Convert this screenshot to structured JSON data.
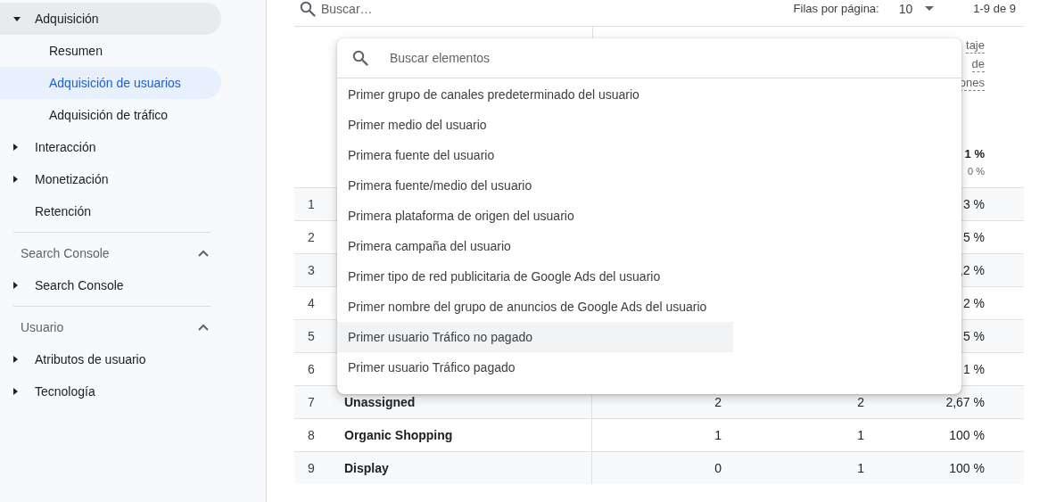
{
  "sidebar": {
    "sections": [
      {
        "items": [
          {
            "label": "Adquisición",
            "kind": "folder",
            "expanded": true,
            "hovered": true,
            "children": [
              {
                "label": "Resumen",
                "selected": false
              },
              {
                "label": "Adquisición de usuarios",
                "selected": true
              },
              {
                "label": "Adquisición de tráfico",
                "selected": false
              }
            ]
          },
          {
            "label": "Interacción",
            "kind": "folder",
            "expanded": false,
            "hovered": false
          },
          {
            "label": "Monetización",
            "kind": "folder",
            "expanded": false,
            "hovered": false
          },
          {
            "label": "Retención",
            "kind": "link",
            "hovered": false
          }
        ]
      },
      {
        "title": "Search Console",
        "expanded": true,
        "items": [
          {
            "label": "Search Console",
            "kind": "folder",
            "expanded": false,
            "hovered": false
          }
        ]
      },
      {
        "title": "Usuario",
        "expanded": true,
        "items": [
          {
            "label": "Atributos de usuario",
            "kind": "folder",
            "expanded": false,
            "hovered": false
          },
          {
            "label": "Tecnología",
            "kind": "folder",
            "expanded": false,
            "hovered": false
          }
        ]
      }
    ]
  },
  "table": {
    "toolbar": {
      "search_placeholder": "Buscar…",
      "rows_per_page_label": "Filas por página:",
      "rows_per_page": "10",
      "range": "1-9 de 9"
    },
    "header": {
      "column_5_lines": [
        "taje",
        "de",
        "ones"
      ],
      "column_5_total": "1 %",
      "column_5_subtotal": "0 %"
    },
    "rows": [
      {
        "number": "1",
        "column_5": "3 %"
      },
      {
        "number": "2",
        "column_5": "5 %"
      },
      {
        "number": "3",
        "column_5": ",2 %"
      },
      {
        "number": "4",
        "column_5": "2 %"
      },
      {
        "number": "5",
        "column_5": "5 %"
      },
      {
        "number": "6",
        "column_5": "1 %"
      },
      {
        "number": "7",
        "dimension": "Unassigned",
        "column_3": "2",
        "column_4": "2",
        "column_5": "2,67 %"
      },
      {
        "number": "8",
        "dimension": "Organic Shopping",
        "column_3": "1",
        "column_4": "1",
        "column_5": "100 %"
      },
      {
        "number": "9",
        "dimension": "Display",
        "column_3": "0",
        "column_4": "1",
        "column_5": "100 %"
      }
    ]
  },
  "dropdown": {
    "search_placeholder": "Buscar elementos",
    "items": [
      {
        "label": "Primer grupo de canales predeterminado del usuario",
        "hovered": false
      },
      {
        "label": "Primer medio del usuario",
        "hovered": false
      },
      {
        "label": "Primera fuente del usuario",
        "hovered": false
      },
      {
        "label": "Primera fuente/medio del usuario",
        "hovered": false
      },
      {
        "label": "Primera plataforma de origen del usuario",
        "hovered": false
      },
      {
        "label": "Primera campaña del usuario",
        "hovered": false
      },
      {
        "label": "Primer tipo de red publicitaria de Google Ads del usuario",
        "hovered": false
      },
      {
        "label": "Primer nombre del grupo de anuncios de Google Ads del usuario",
        "hovered": false
      },
      {
        "label": "Primer usuario Tráfico no pagado",
        "hovered": true
      },
      {
        "label": "Primer usuario Tráfico pagado",
        "hovered": false
      }
    ]
  }
}
